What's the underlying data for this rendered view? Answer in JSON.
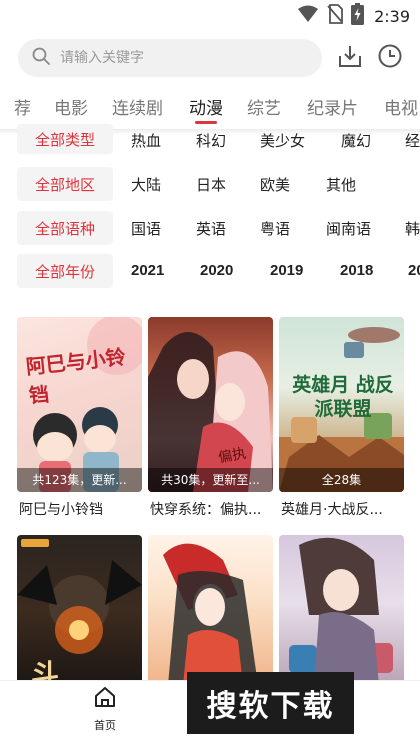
{
  "status_bar": {
    "time": "2:39",
    "icons": [
      "wifi-icon",
      "no-sim-icon",
      "battery-charging-icon"
    ]
  },
  "search": {
    "placeholder": "请输入关键字",
    "icons": [
      "search-icon",
      "download-icon",
      "history-icon"
    ]
  },
  "tabs": {
    "items": [
      "荐",
      "电影",
      "连续剧",
      "动漫",
      "综艺",
      "纪录片",
      "电视"
    ],
    "active_index": 3,
    "accent_color": "#d9363e"
  },
  "filters": {
    "type": {
      "label": "全部类型",
      "options": [
        "热血",
        "科幻",
        "美少女",
        "魔幻",
        "经"
      ]
    },
    "region": {
      "label": "全部地区",
      "options": [
        "大陆",
        "日本",
        "欧美",
        "其他"
      ]
    },
    "language": {
      "label": "全部语种",
      "options": [
        "国语",
        "英语",
        "粤语",
        "闽南语",
        "韩"
      ]
    },
    "year": {
      "label": "全部年份",
      "options": [
        "2021",
        "2020",
        "2019",
        "2018",
        "20"
      ]
    },
    "label_color": "#e0343c"
  },
  "cards": [
    {
      "title": "阿巳与小铃铛",
      "badge": "共123集，更新...",
      "poster_text": "阿巳与小铃铛"
    },
    {
      "title": "快穿系统：偏执...",
      "badge": "共30集，更新至...",
      "poster_text": "偏执"
    },
    {
      "title": "英雄月·大战反...",
      "badge": "全28集",
      "poster_text": "英雄月 战反派联盟"
    },
    {
      "title": "",
      "badge": "",
      "poster_text": "斗"
    },
    {
      "title": "",
      "badge": "",
      "poster_text": ""
    },
    {
      "title": "",
      "badge": "",
      "poster_text": ""
    }
  ],
  "bottom_nav": {
    "home_label": "首页",
    "icon": "home-icon"
  },
  "watermark": {
    "text": "搜软下载"
  }
}
